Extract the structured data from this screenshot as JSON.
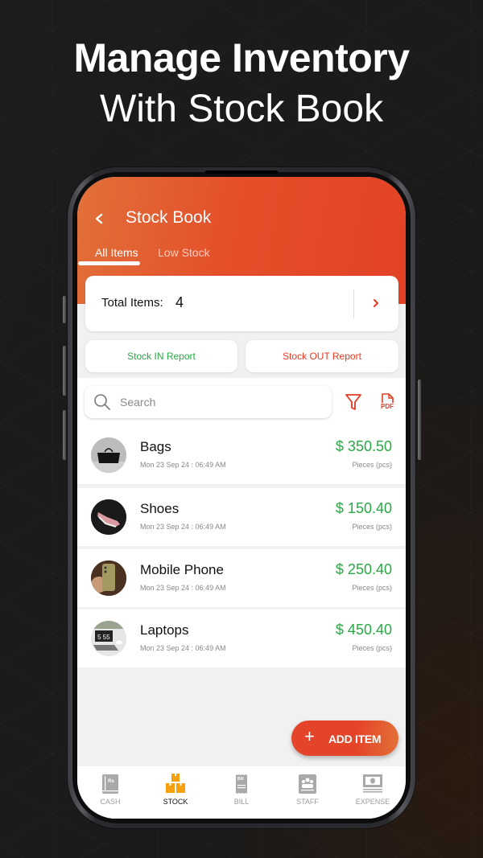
{
  "promo": {
    "line1": "Manage Inventory",
    "line2": "With Stock Book"
  },
  "header": {
    "back_icon": "chevron-left-icon",
    "title": "Stock Book",
    "gradient_start": "#e2703a",
    "gradient_end": "#e34224"
  },
  "tabs": [
    {
      "label": "All Items",
      "active": true
    },
    {
      "label": "Low Stock",
      "active": false
    }
  ],
  "summary": {
    "total_label": "Total Items:",
    "total_value": "4",
    "arrow_icon": "chevron-right-icon"
  },
  "reports": {
    "in_label": "Stock IN Report",
    "out_label": "Stock OUT Report",
    "in_color": "#2aa845",
    "out_color": "#e23b21"
  },
  "search": {
    "placeholder": "Search",
    "value": "",
    "filter_icon": "filter-icon",
    "pdf_icon": "pdf-icon",
    "pdf_text": "PDF"
  },
  "items": [
    {
      "name": "Bags",
      "date": "Mon 23 Sep 24 : 06:49 AM",
      "price": "$ 350.50",
      "unit": "Pieces (pcs)",
      "image": "bag-photo"
    },
    {
      "name": "Shoes",
      "date": "Mon 23 Sep 24 : 06:49 AM",
      "price": "$ 150.40",
      "unit": "Pieces (pcs)",
      "image": "shoe-photo"
    },
    {
      "name": "Mobile Phone",
      "date": "Mon 23 Sep 24 : 06:49 AM",
      "price": "$ 250.40",
      "unit": "Pieces (pcs)",
      "image": "phone-photo"
    },
    {
      "name": "Laptops",
      "date": "Mon 23 Sep 24 : 06:49 AM",
      "price": "$ 450.40",
      "unit": "Pieces (pcs)",
      "image": "laptop-photo"
    }
  ],
  "fab": {
    "icon": "plus-icon",
    "plus": "+",
    "label": "ADD ITEM"
  },
  "bottom_nav": [
    {
      "label": "CASH",
      "icon": "cash-book-icon",
      "icon_text": "Rs",
      "active": false
    },
    {
      "label": "STOCK",
      "icon": "stock-boxes-icon",
      "active": true
    },
    {
      "label": "BILL",
      "icon": "bill-receipt-icon",
      "icon_text": "Bill",
      "active": false
    },
    {
      "label": "STAFF",
      "icon": "staff-group-icon",
      "active": false
    },
    {
      "label": "EXPENSE",
      "icon": "expense-money-icon",
      "active": false
    }
  ],
  "colors": {
    "accent": "#e4502a",
    "price_green": "#2aa845",
    "nav_active_icon": "#f5a10f",
    "nav_inactive": "#9a9a9a"
  }
}
